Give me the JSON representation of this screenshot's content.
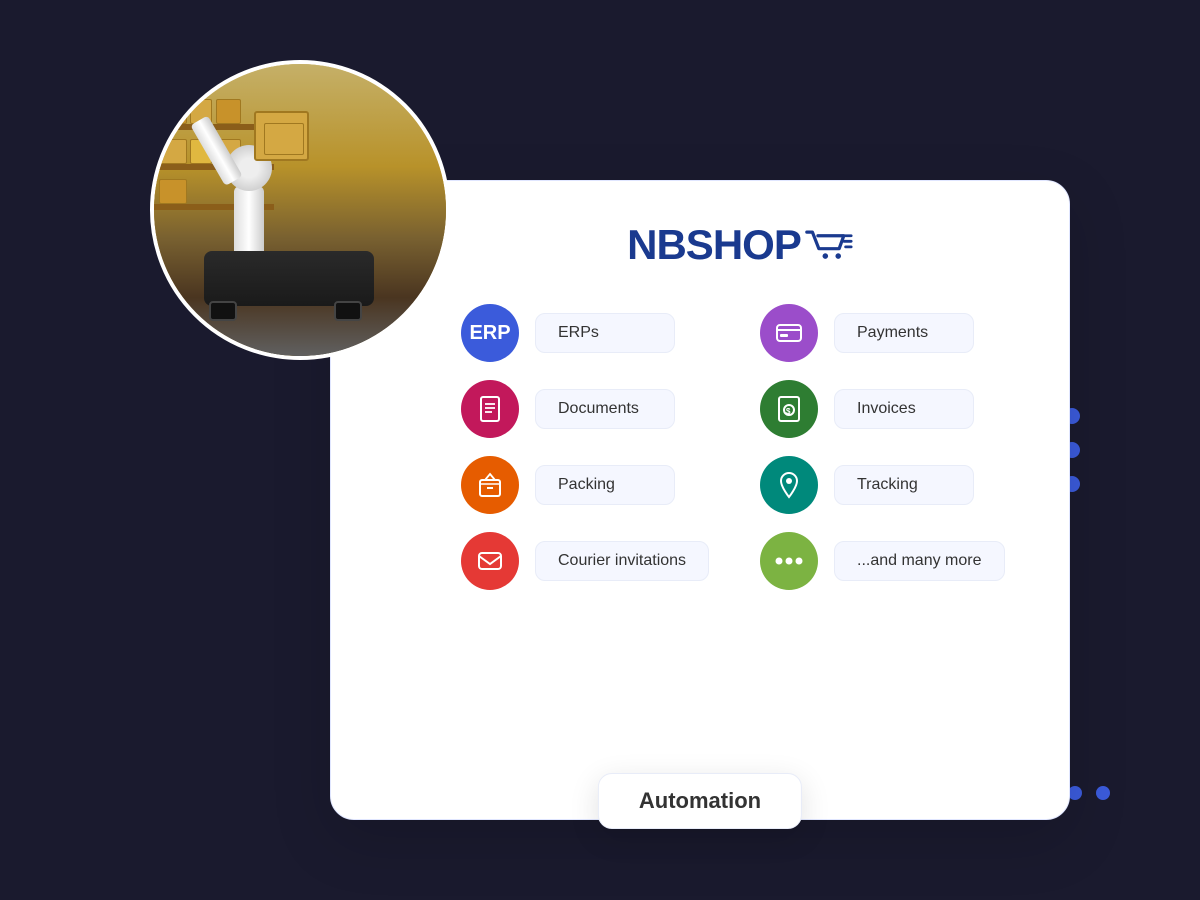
{
  "logo": {
    "text": "NBSHOP",
    "cart_icon": "cart-icon"
  },
  "features": [
    {
      "id": "erp",
      "icon_type": "text",
      "icon_text": "ERP",
      "icon_color": "icon-blue",
      "label": "ERPs"
    },
    {
      "id": "payments",
      "icon_type": "symbol",
      "icon_symbol": "💳",
      "icon_color": "icon-purple",
      "label": "Payments"
    },
    {
      "id": "documents",
      "icon_type": "symbol",
      "icon_symbol": "📄",
      "icon_color": "icon-magenta",
      "label": "Documents"
    },
    {
      "id": "invoices",
      "icon_type": "symbol",
      "icon_symbol": "🧾",
      "icon_color": "icon-green",
      "label": "Invoices"
    },
    {
      "id": "packing",
      "icon_type": "symbol",
      "icon_symbol": "📦",
      "icon_color": "icon-orange",
      "label": "Packing"
    },
    {
      "id": "tracking",
      "icon_type": "symbol",
      "icon_symbol": "📍",
      "icon_color": "icon-teal",
      "label": "Tracking"
    },
    {
      "id": "courier",
      "icon_type": "symbol",
      "icon_symbol": "✉️",
      "icon_color": "icon-red",
      "label": "Courier invitations"
    },
    {
      "id": "more",
      "icon_type": "symbol",
      "icon_symbol": "•••",
      "icon_color": "icon-lime",
      "label": "...and many more"
    }
  ],
  "automation": {
    "badge_label": "Automation"
  },
  "dots": {
    "count": 3,
    "color": "#3b5bdb"
  }
}
